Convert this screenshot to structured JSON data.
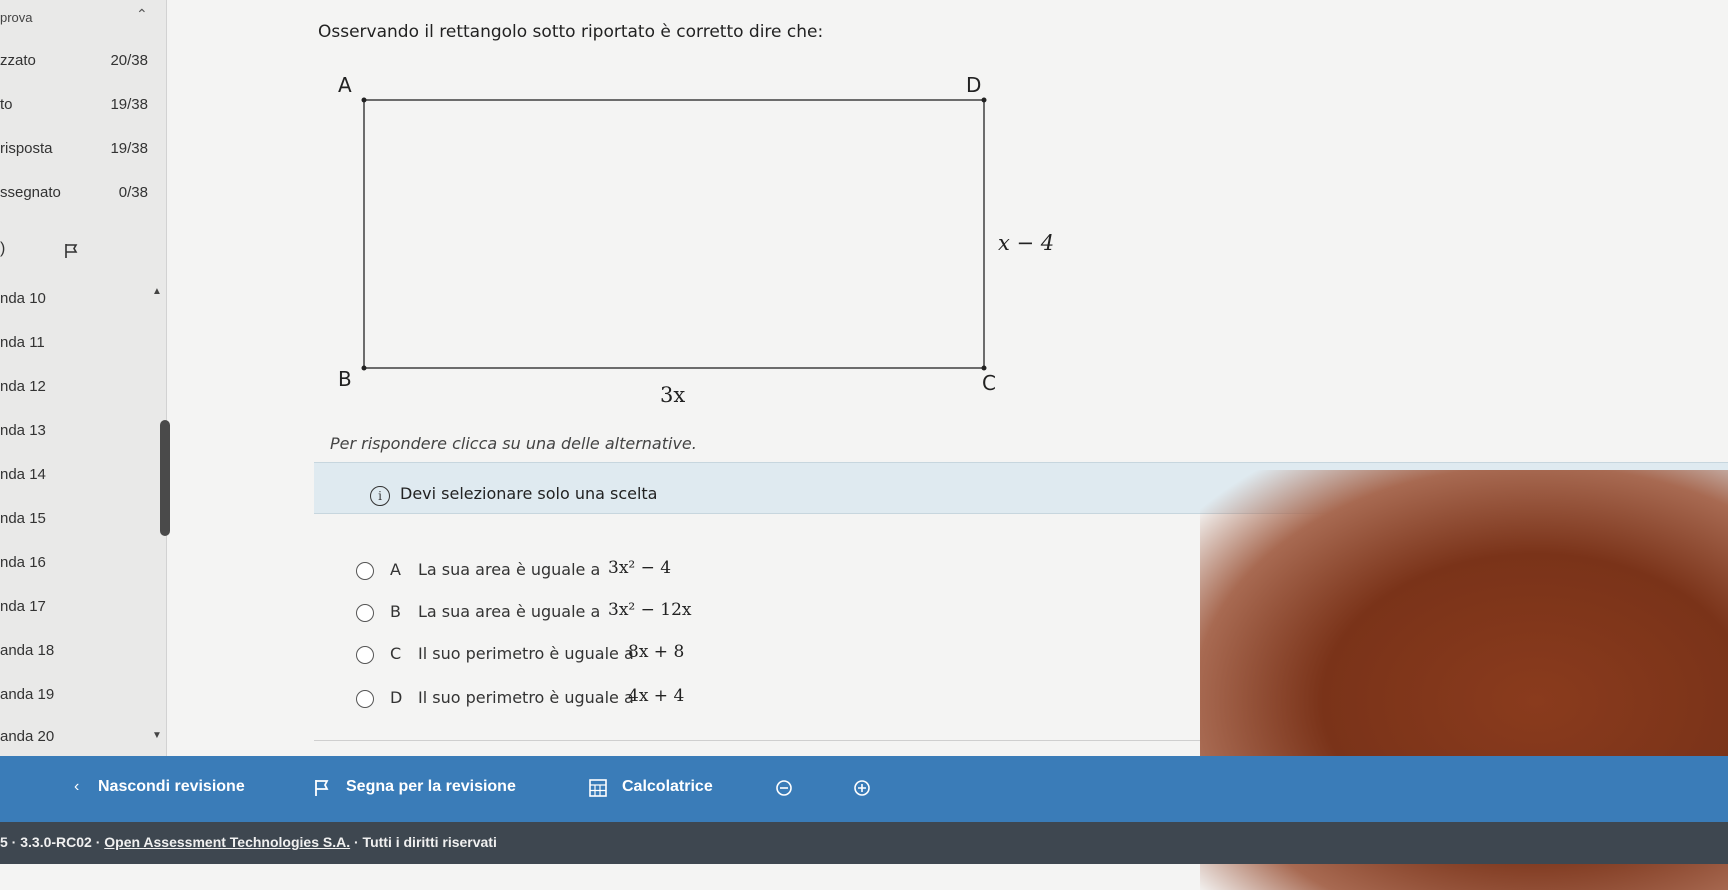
{
  "sidebar": {
    "title": "prova",
    "collapse_icon": "chevron-up-icon",
    "stats": [
      {
        "label": "zzato",
        "value": "20/38"
      },
      {
        "label": "to",
        "value": "19/38"
      },
      {
        "label": "risposta",
        "value": "19/38"
      },
      {
        "label": "ssegnato",
        "value": "0/38"
      }
    ],
    "tools": {
      "text": ")",
      "flag_icon": "flag-icon"
    },
    "questions": [
      "nda 10",
      "nda 11",
      "nda 12",
      "nda 13",
      "nda 14",
      "nda 15",
      "nda 16",
      "nda 17",
      "anda 18",
      "anda 19",
      "anda 20"
    ]
  },
  "main": {
    "question": "Osservando il rettangolo sotto riportato è corretto dire che:",
    "diagram": {
      "vertices": [
        "A",
        "D",
        "B",
        "C"
      ],
      "right_side_label": "x − 4",
      "bottom_side_label": "3x"
    },
    "instruction": "Per rispondere clicca su una delle alternative.",
    "info": {
      "icon": "info-icon",
      "text": "Devi selezionare solo una scelta"
    },
    "options": [
      {
        "letter": "A",
        "text": "La sua area è uguale a",
        "math": "3x² − 4"
      },
      {
        "letter": "B",
        "text": "La sua area è uguale a",
        "math": "3x² − 12x"
      },
      {
        "letter": "C",
        "text": "Il suo perimetro è uguale a",
        "math": "8x + 8"
      },
      {
        "letter": "D",
        "text": "Il suo perimetro è uguale a",
        "math": "4x + 4"
      }
    ]
  },
  "toolbar": {
    "hide_review": "Nascondi revisione",
    "mark_review": "Segna per la revisione",
    "calculator": "Calcolatrice"
  },
  "footer": {
    "text_prefix": "5 · 3.3.0-RC02 · ",
    "link": "Open Assessment Technologies S.A.",
    "text_suffix": " · Tutti i diritti riservati"
  },
  "colors": {
    "toolbar_bg": "#3a7cb8",
    "footer_bg": "#3e4750",
    "info_bg": "#dfeaf0"
  }
}
